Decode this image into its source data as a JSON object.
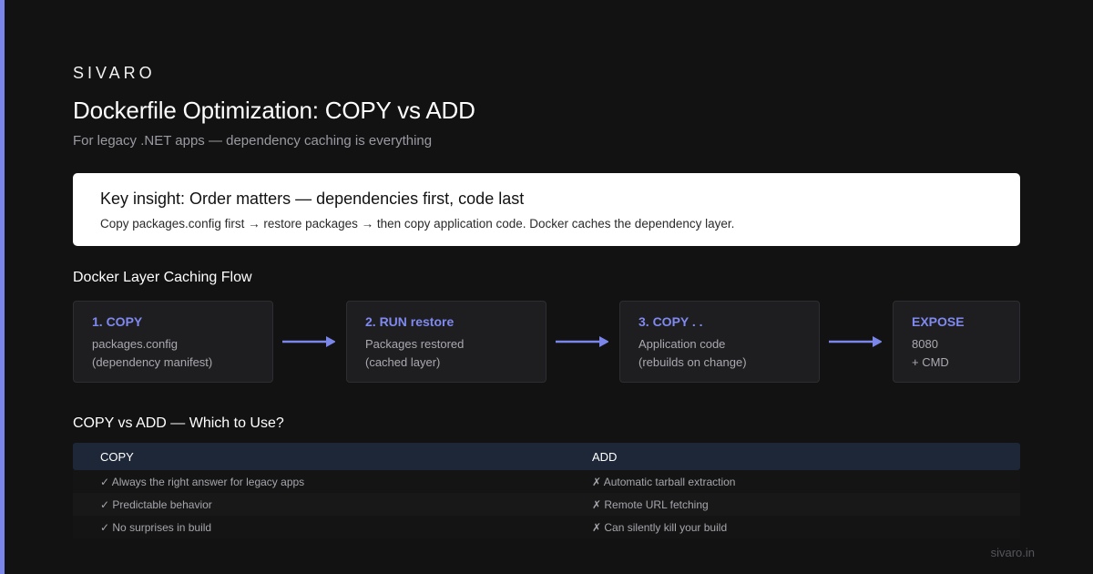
{
  "brand": "SIVARO",
  "title": "Dockerfile Optimization: COPY vs ADD",
  "subtitle": "For legacy .NET apps — dependency caching is everything",
  "insight": {
    "heading": "Key insight: Order matters — dependencies first, code last",
    "body": "Copy packages.config first → restore packages → then copy application code. Docker caches the dependency layer."
  },
  "flow": {
    "label": "Docker Layer Caching Flow",
    "steps": [
      {
        "title": "1. COPY",
        "line1": "packages.config",
        "line2": "(dependency manifest)"
      },
      {
        "title": "2. RUN restore",
        "line1": "Packages restored",
        "line2": "(cached layer)"
      },
      {
        "title": "3. COPY . .",
        "line1": "Application code",
        "line2": "(rebuilds on change)"
      },
      {
        "title": "EXPOSE",
        "line1": "8080",
        "line2": "+ CMD"
      }
    ]
  },
  "comparison": {
    "label": "COPY vs ADD — Which to Use?",
    "headers": [
      "COPY",
      "ADD"
    ],
    "rows": [
      [
        "✓ Always the right answer for legacy apps",
        "✗ Automatic tarball extraction"
      ],
      [
        "✓ Predictable behavior",
        "✗ Remote URL fetching"
      ],
      [
        "✓ No surprises in build",
        "✗ Can silently kill your build"
      ]
    ]
  },
  "footer": "sivaro.in",
  "colors": {
    "background": "#121212",
    "accent": "#7b86ea",
    "table_header": "#1d2738"
  }
}
